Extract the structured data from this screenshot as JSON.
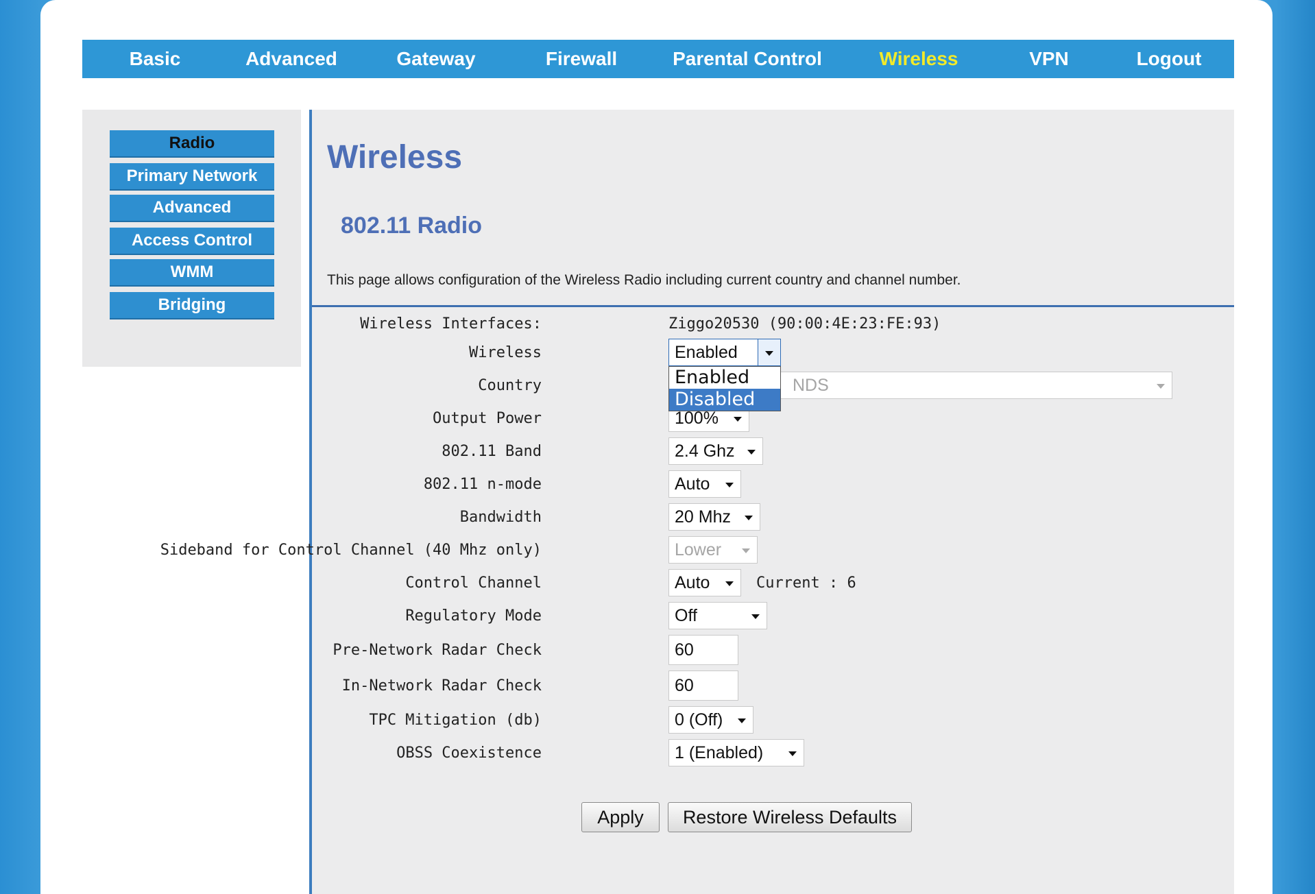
{
  "nav": {
    "items": [
      {
        "label": "Basic"
      },
      {
        "label": "Advanced"
      },
      {
        "label": "Gateway"
      },
      {
        "label": "Firewall"
      },
      {
        "label": "Parental Control"
      },
      {
        "label": "Wireless"
      },
      {
        "label": "VPN"
      },
      {
        "label": "Logout"
      }
    ],
    "active": "Wireless",
    "active_color": "#f2ea2a"
  },
  "sidebar": {
    "items": [
      {
        "label": "Radio"
      },
      {
        "label": "Primary Network"
      },
      {
        "label": "Advanced"
      },
      {
        "label": "Access Control"
      },
      {
        "label": "WMM"
      },
      {
        "label": "Bridging"
      }
    ],
    "active": "Radio"
  },
  "main": {
    "title": "Wireless",
    "section_title": "802.11 Radio",
    "description": "This page allows configuration of the Wireless Radio including current country and channel number."
  },
  "form": {
    "interfaces_label": "Wireless Interfaces:",
    "interfaces_value": "Ziggo20530 (90:00:4E:23:FE:93)",
    "wireless_label": "Wireless",
    "wireless_value": "Enabled",
    "wireless_options": [
      "Enabled",
      "Disabled"
    ],
    "wireless_highlighted": "Disabled",
    "country_label": "Country",
    "country_value": "NDS",
    "output_power_label": "Output Power",
    "output_power_value": "100%",
    "band_label": "802.11 Band",
    "band_value": "2.4 Ghz",
    "nmode_label": "802.11 n-mode",
    "nmode_value": "Auto",
    "bandwidth_label": "Bandwidth",
    "bandwidth_value": "20 Mhz",
    "sideband_label": "Sideband for Control Channel (40 Mhz only)",
    "sideband_value": "Lower",
    "control_channel_label": "Control Channel",
    "control_channel_value": "Auto",
    "control_channel_current": "Current : 6",
    "regulatory_label": "Regulatory Mode",
    "regulatory_value": "Off",
    "pre_radar_label": "Pre-Network Radar Check",
    "pre_radar_value": "60",
    "in_radar_label": "In-Network Radar Check",
    "in_radar_value": "60",
    "tpc_label": "TPC Mitigation (db)",
    "tpc_value": "0 (Off)",
    "obss_label": "OBSS Coexistence",
    "obss_value": "1 (Enabled)"
  },
  "buttons": {
    "apply": "Apply",
    "restore": "Restore Wireless Defaults"
  },
  "colors": {
    "nav_bg": "#2e97d6",
    "heading": "#4e6fb6",
    "sidebar_button": "#2e8fd0",
    "divider": "#3d6fb0"
  }
}
